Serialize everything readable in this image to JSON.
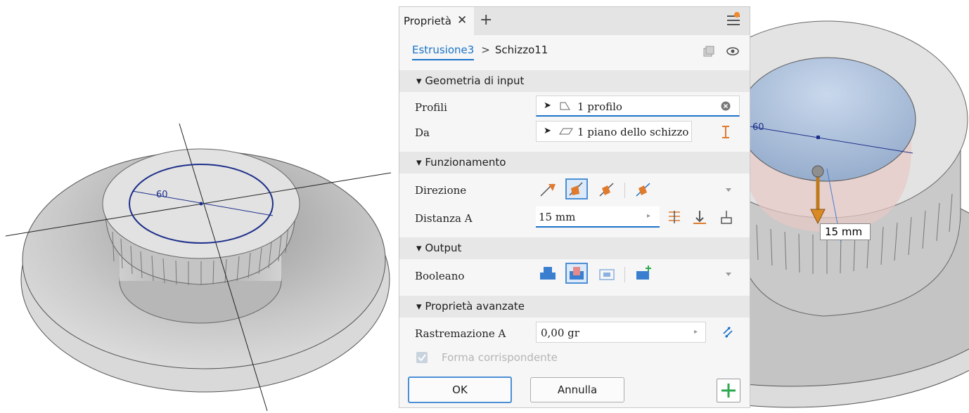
{
  "panel": {
    "tab_label": "Proprietà",
    "breadcrumb": {
      "active": "Estrusione3",
      "separator": ">",
      "current": "Schizzo11"
    },
    "sections": {
      "input_geometry": "Geometria di input",
      "behavior": "Funzionamento",
      "output": "Output",
      "advanced": "Proprietà avanzate"
    },
    "rows": {
      "profiles_label": "Profili",
      "profiles_value": "1 profilo",
      "from_label": "Da",
      "from_value": "1 piano dello schizzo",
      "direction_label": "Direzione",
      "distance_label": "Distanza A",
      "distance_value": "15 mm",
      "boolean_label": "Booleano",
      "taper_label": "Rastremazione A",
      "taper_value": "0,00 gr",
      "match_shape_label": "Forma corrispondente",
      "match_shape_checked": true
    },
    "buttons": {
      "ok": "OK",
      "cancel": "Annulla"
    },
    "icons": [
      "close-icon",
      "plus-icon",
      "menu-icon",
      "select-arrow-icon",
      "profile-icon",
      "clear-icon",
      "plane-icon",
      "extents-icon",
      "direction-default-icon",
      "direction-flip-icon",
      "direction-symmetric-icon",
      "direction-asymmetric-icon",
      "flip-icon",
      "to-icon",
      "measure-icon",
      "boolean-join-icon",
      "boolean-cut-icon",
      "boolean-intersect-icon",
      "new-solid-icon",
      "taper-flip-icon",
      "visibility-icon",
      "preview-icon"
    ]
  },
  "viewport_left": {
    "dimension": "60"
  },
  "viewport_right": {
    "dimension": "60",
    "distance_tag": "15 mm"
  },
  "colors": {
    "accent": "#1a73c8",
    "orange": "#e07a2c",
    "notify": "#f08a2c",
    "sketch": "#1d2f8a",
    "add_green": "#2fa84f"
  }
}
